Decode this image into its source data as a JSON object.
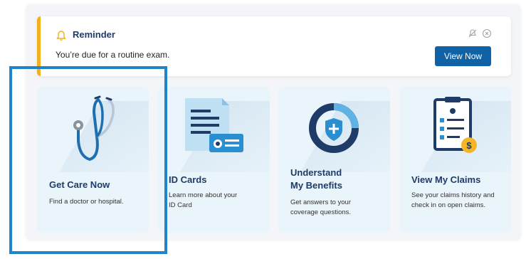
{
  "reminder": {
    "title": "Reminder",
    "message": "You’re due for a routine exam.",
    "button_label": "View Now",
    "accent_color": "#f2b01e",
    "icon": "bell-icon"
  },
  "cards": [
    {
      "title": "Get Care Now",
      "description": "Find a doctor or hospital.",
      "icon": "stethoscope-icon"
    },
    {
      "title": "ID Cards",
      "description_lines": [
        "Learn more about your",
        "ID Card"
      ],
      "icon": "id-card-icon"
    },
    {
      "title_lines": [
        "Understand",
        "My Benefits"
      ],
      "description_lines": [
        "Get answers to your",
        "coverage questions."
      ],
      "icon": "benefits-shield-icon"
    },
    {
      "title": "View My Claims",
      "description_lines": [
        "See your claims history and",
        "check in on open claims."
      ],
      "icon": "claims-clipboard-icon"
    }
  ],
  "colors": {
    "brand_navy": "#1f3b67",
    "button_blue": "#0f62a6",
    "card_background": "#e9f4fb",
    "highlight_blue": "#1f85c8"
  }
}
